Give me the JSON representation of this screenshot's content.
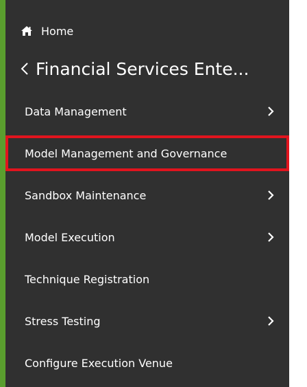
{
  "home": {
    "label": "Home",
    "icon": "home-icon"
  },
  "back": {
    "label": "Financial Services Ente...",
    "icon": "chevron-left-icon"
  },
  "menu": {
    "items": [
      {
        "label": "Data Management",
        "has_submenu": true
      },
      {
        "label": "Model Management and Governance",
        "has_submenu": false,
        "highlighted": true
      },
      {
        "label": "Sandbox Maintenance",
        "has_submenu": true
      },
      {
        "label": "Model Execution",
        "has_submenu": true
      },
      {
        "label": "Technique Registration",
        "has_submenu": false
      },
      {
        "label": "Stress Testing",
        "has_submenu": true
      },
      {
        "label": "Configure Execution Venue",
        "has_submenu": false
      }
    ]
  },
  "colors": {
    "sidebar_bg": "#303030",
    "accent": "#5a9e2e",
    "highlight_border": "#e1141e",
    "text": "#ffffff"
  }
}
